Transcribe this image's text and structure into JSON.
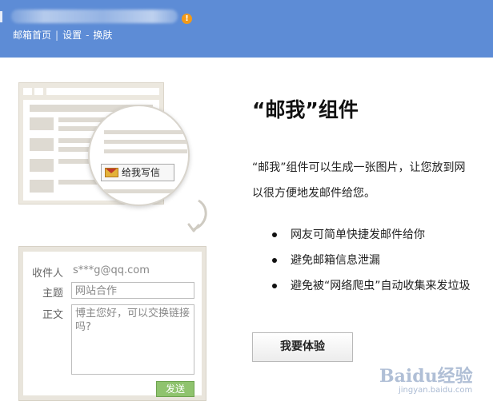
{
  "header": {
    "nav": [
      "邮箱首页",
      "设置",
      "换肤"
    ],
    "separator_pipe": "|",
    "separator_dash": "-",
    "alert_icon": "!",
    "colors": {
      "bar": "#5d8cd6",
      "alert": "#f29a19"
    }
  },
  "illustration": {
    "mail_me_button": "给我写信",
    "form": {
      "to_label": "收件人",
      "to_value": "s***g@qq.com",
      "subject_label": "主题",
      "subject_value": "网站合作",
      "body_label": "正文",
      "body_value": "博主您好，可以交换链接吗?",
      "send_label": "发送"
    }
  },
  "content": {
    "title": "“邮我”组件",
    "description_line1": "“邮我”组件可以生成一张图片，让您放到网",
    "description_line2": "以很方便地发邮件给您。",
    "features": [
      "网友可简单快捷发邮件给你",
      "避免邮箱信息泄漏",
      "避免被“网络爬虫”自动收集来发垃圾"
    ],
    "try_button": "我要体验"
  },
  "watermark": {
    "main": "Baidu经验",
    "sub": "jingyan.baidu.com"
  }
}
